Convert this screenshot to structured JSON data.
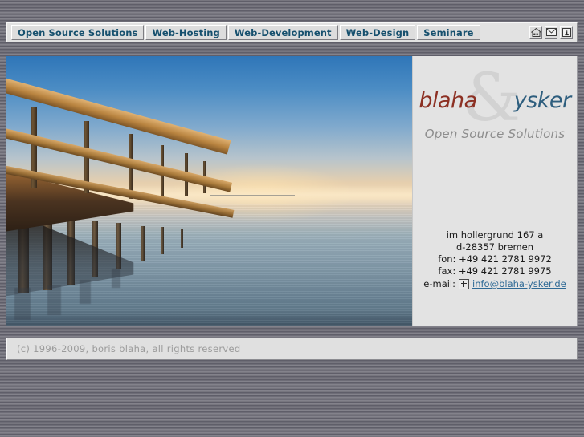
{
  "nav": {
    "items": [
      {
        "label": "Open Source Solutions",
        "name": "nav-open-source-solutions"
      },
      {
        "label": "Web-Hosting",
        "name": "nav-web-hosting"
      },
      {
        "label": "Web-Development",
        "name": "nav-web-development"
      },
      {
        "label": "Web-Design",
        "name": "nav-web-design"
      },
      {
        "label": "Seminare",
        "name": "nav-seminare"
      }
    ],
    "icons": [
      {
        "name": "home-icon",
        "title": "home"
      },
      {
        "name": "mail-icon",
        "title": "mail"
      },
      {
        "name": "info-icon",
        "title": "info"
      }
    ]
  },
  "hero": {
    "alt": "wooden pier extending over calm water at sunset"
  },
  "logo": {
    "word_left": "blaha",
    "ampersand": "&",
    "word_right": "ysker",
    "tagline": "Open Source Solutions",
    "color_left": "#8c3023",
    "color_right": "#2e5e7e",
    "color_ampersand": "#d2d2d2",
    "color_tagline": "#8d8d8d"
  },
  "contact": {
    "street": "im hollergrund 167 a",
    "city": "d-28357 bremen",
    "fon": "fon:  +49 421 2781 9972",
    "fax": "fax:  +49 421 2781 9975",
    "email_label": "e-mail:",
    "email": "info@blaha-ysker.de",
    "email_color": "#2f6a96"
  },
  "footer": {
    "copyright": "(c) 1996-2009, boris blaha, all rights reserved"
  },
  "theme": {
    "page_background": "#6b6a74",
    "panel_background": "#e3e3e3",
    "nav_text": "#16506e"
  }
}
